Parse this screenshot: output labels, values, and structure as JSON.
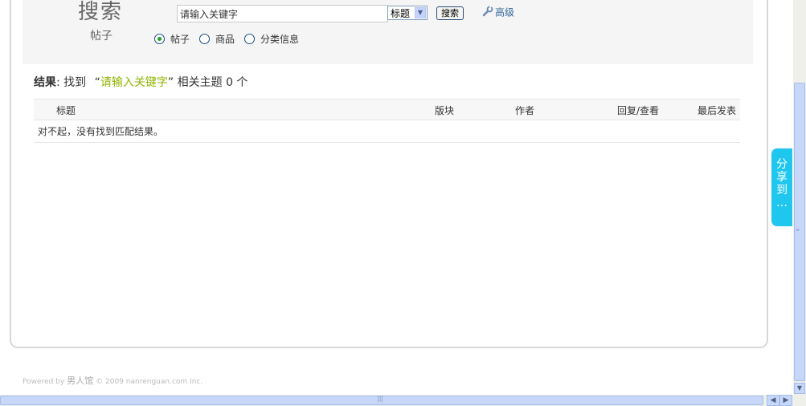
{
  "search": {
    "title": "搜索",
    "subtitle": "帖子",
    "keyword_value": "请输入关键字",
    "type_select_value": "标题",
    "submit_label": "搜索",
    "advanced_label": "高级",
    "scope_options": [
      {
        "label": "帖子",
        "checked": true
      },
      {
        "label": "商品",
        "checked": false
      },
      {
        "label": "分类信息",
        "checked": false
      }
    ]
  },
  "results": {
    "label": "结果",
    "found_text": ": 找到",
    "open_quote": "“",
    "keyword": "请输入关键字",
    "close_quote": "”",
    "suffix": "相关主题",
    "count": "0 个"
  },
  "table": {
    "columns": [
      "标题",
      "版块",
      "作者",
      "回复/查看",
      "最后发表"
    ],
    "empty_message": "对不起，没有找到匹配结果。"
  },
  "footer": {
    "powered_by": "Powered by",
    "brand": "男人馆",
    "copyright": "© 2009 nanrenguan.com Inc."
  },
  "share": {
    "chars": [
      "分",
      "享",
      "到",
      "…"
    ]
  },
  "colors": {
    "keyword_highlight": "#8fb500",
    "share_tab": "#1fc6ee",
    "panel_bg": "#f5f5f5",
    "radio_dot": "#21a121"
  }
}
